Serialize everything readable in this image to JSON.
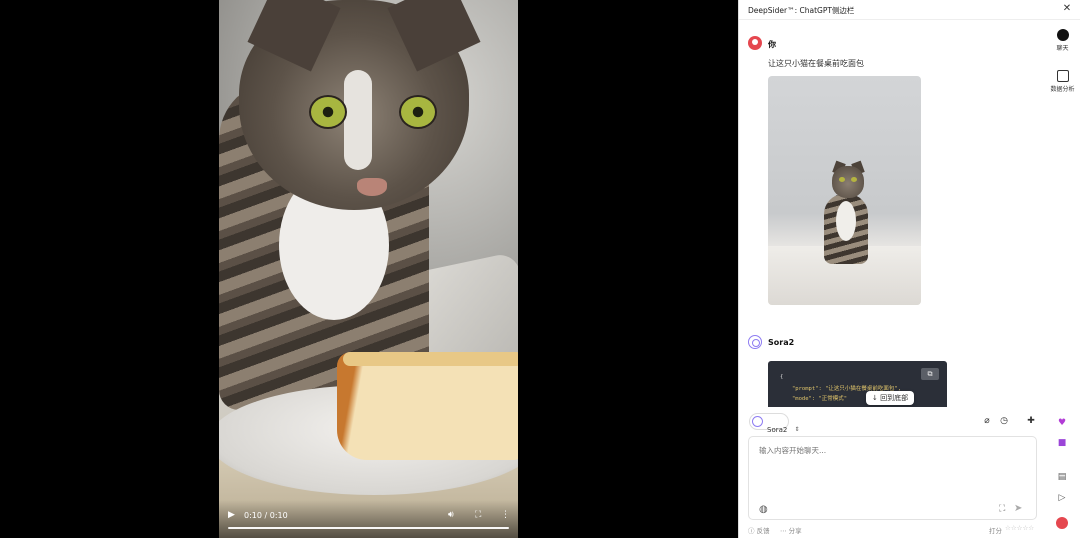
{
  "video": {
    "time": "0:10 / 0:10",
    "progress": 1.0,
    "icons": {
      "play": "play-icon",
      "volume": "volume-icon",
      "fullscreen": "fullscreen-icon",
      "more": "more-vertical-icon"
    }
  },
  "panel": {
    "title": "DeepSider™: ChatGPT侧边栏",
    "close_icon": "close-icon"
  },
  "chat": {
    "user": {
      "name": "你",
      "message": "让这只小猫在餐桌前吃面包"
    },
    "assistant": {
      "name": "Sora2",
      "code_lines": [
        "{",
        "\"prompt\": \"让这只小猫在餐桌前吃面包\",",
        "\"mode\": \"正常模式\""
      ]
    },
    "scroll_to_bottom": "回到底部"
  },
  "composer": {
    "model": "Sora2",
    "placeholder": "输入内容开始聊天..."
  },
  "footer": {
    "feedback": "反馈",
    "share": "分享",
    "rating_label": "打分",
    "stars": "☆☆☆☆☆"
  },
  "rail": {
    "chat_label": "聊天",
    "data_label": "数据分析"
  },
  "colors": {
    "accent_purple": "#8e7cf2",
    "user_red": "#e5474f",
    "code_bg": "#2b2f38"
  }
}
